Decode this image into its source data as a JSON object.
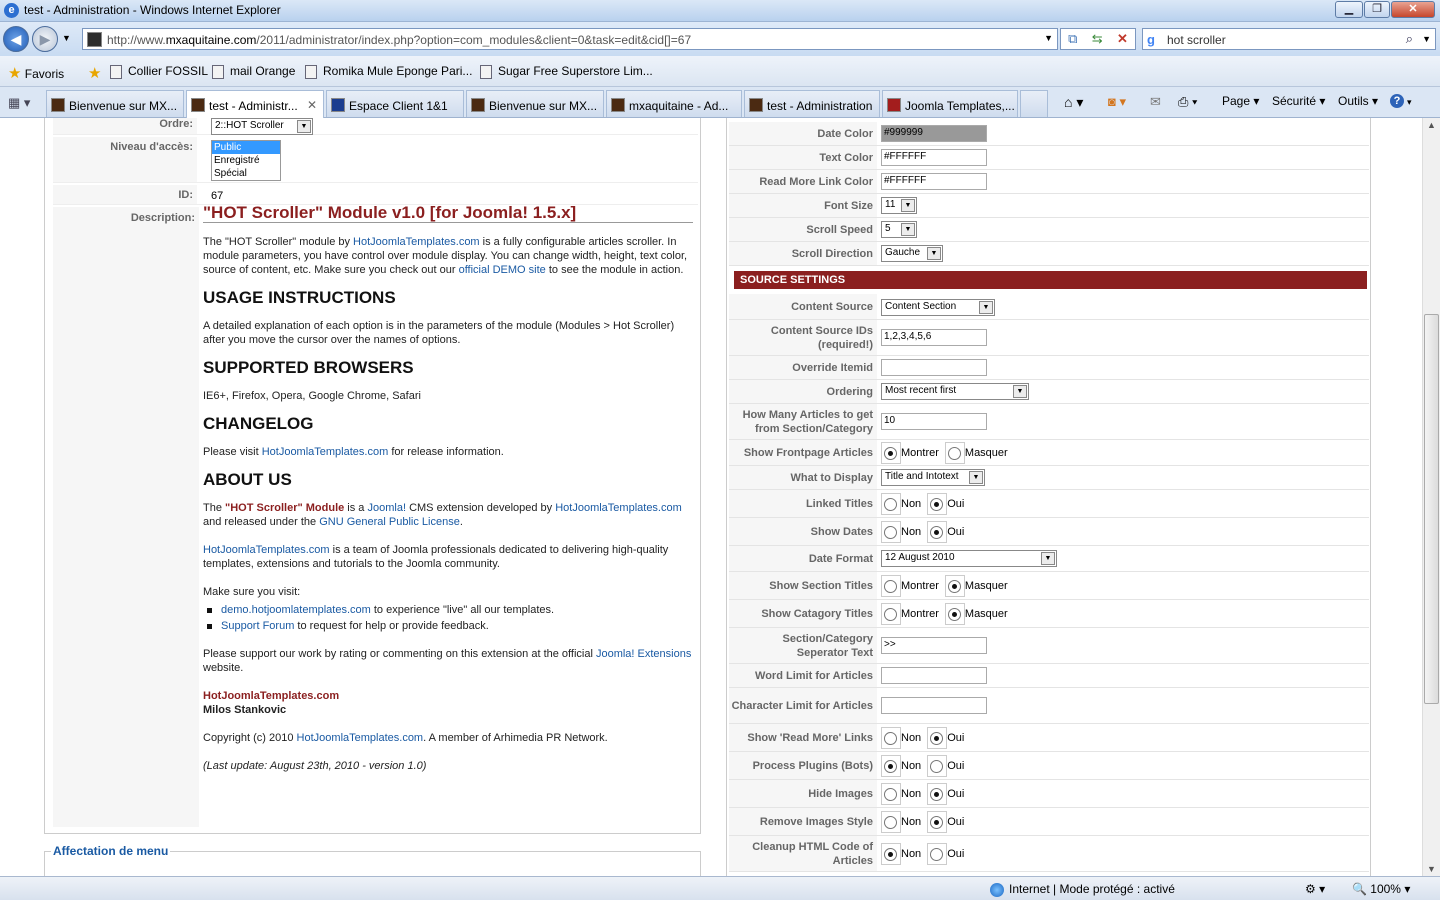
{
  "window": {
    "title": "test - Administration - Windows Internet Explorer",
    "min": "▁",
    "max": "❐",
    "close": "✕"
  },
  "address": {
    "url_prefix": "http://www.",
    "url_domain": "mxaquitaine.com",
    "url_path": "/2011/administrator/index.php?option=com_modules&client=0&task=edit&cid[]=67",
    "search_value": "hot scroller"
  },
  "favorites": {
    "label": "Favoris",
    "items": [
      "Collier FOSSIL",
      "mail Orange",
      "Romika Mule Eponge Pari...",
      "Sugar Free Superstore Lim..."
    ]
  },
  "tabs": [
    "Bienvenue sur MX...",
    "test - Administr...",
    "Espace Client 1&1",
    "Bienvenue sur MX...",
    "mxaquitaine - Ad...",
    "test - Administration",
    "Joomla Templates,..."
  ],
  "commandbar": {
    "page": "Page",
    "security": "Sécurité",
    "tools": "Outils",
    "help": "?"
  },
  "left": {
    "order_label": "Ordre:",
    "order_value": "2::HOT Scroller",
    "access_label": "Niveau d'accès:",
    "access_options": [
      "Public",
      "Enregistré",
      "Spécial"
    ],
    "id_label": "ID:",
    "id_value": "67",
    "description_label": "Description:",
    "desc": {
      "title": "\"HOT Scroller\" Module v1.0 [for Joomla! 1.5.x]",
      "p1a": "The \"HOT Scroller\" module by ",
      "p1link": "HotJoomlaTemplates.com",
      "p1b": " is a fully configurable articles scroller. In module parameters, you have control over module display. You can change width, height, text color, source of content, etc. Make sure you check out our ",
      "p1link2": "official DEMO site",
      "p1c": " to see the module in action.",
      "h_usage": "USAGE INSTRUCTIONS",
      "usage": "A detailed explanation of each option is in the parameters of the module (Modules > Hot Scroller) after you move the cursor over the names of options.",
      "h_browsers": "SUPPORTED BROWSERS",
      "browsers": "IE6+, Firefox, Opera, Google Chrome, Safari",
      "h_changelog": "CHANGELOG",
      "changelog_a": "Please visit ",
      "changelog_link": "HotJoomlaTemplates.com",
      "changelog_b": " for release information.",
      "h_about": "ABOUT US",
      "about_a": "The ",
      "about_red": "\"HOT Scroller\" Module",
      "about_b": " is a ",
      "about_joomla": "Joomla!",
      "about_c": " CMS extension developed by ",
      "about_link": "HotJoomlaTemplates.com",
      "about_d": " and released under the ",
      "about_gpl": "GNU General Public License",
      "about_e": ".",
      "team_link": "HotJoomlaTemplates.com",
      "team": " is a team of Joomla professionals dedicated to delivering high-quality templates, extensions and tutorials to the Joomla community.",
      "visit": "Make sure you visit:",
      "li1_link": "demo.hotjoomlatemplates.com",
      "li1": " to experience \"live\" all our templates.",
      "li2_link": "Support Forum",
      "li2": " to request for help or provide feedback.",
      "support_a": "Please support our work by rating or commenting on this extension at the official ",
      "support_link": "Joomla! Extensions",
      "support_b": " website.",
      "sig_company": "HotJoomlaTemplates.com",
      "sig_name": "Milos Stankovic",
      "copy_a": "Copyright (c) 2010 ",
      "copy_link": "HotJoomlaTemplates.com",
      "copy_b": ". A member of Arhimedia PR Network.",
      "lastupdate": "(Last update: August 23th, 2010 - version 1.0)"
    },
    "menu_assign": "Affectation de menu"
  },
  "right": {
    "date_color_label": "Date Color",
    "date_color": "#999999",
    "text_color_label": "Text Color",
    "text_color": "#FFFFFF",
    "readmore_color_label": "Read More Link Color",
    "readmore_color": "#FFFFFF",
    "font_size_label": "Font Size",
    "font_size": "11",
    "scroll_speed_label": "Scroll Speed",
    "scroll_speed": "5",
    "scroll_dir_label": "Scroll Direction",
    "scroll_dir": "Gauche",
    "source_header": "SOURCE SETTINGS",
    "content_source_label": "Content Source",
    "content_source": "Content Section",
    "content_ids_label": "Content Source IDs (required!)",
    "content_ids": "1,2,3,4,5,6",
    "override_label": "Override Itemid",
    "override": "",
    "ordering_label": "Ordering",
    "ordering": "Most recent first",
    "howmany_label": "How Many Articles to get from Section/Category",
    "howmany": "10",
    "frontpage_label": "Show Frontpage Articles",
    "what_label": "What to Display",
    "what": "Title and Intotext",
    "linked_label": "Linked Titles",
    "dates_label": "Show Dates",
    "datefmt_label": "Date Format",
    "datefmt": "12 August 2010",
    "section_titles_label": "Show Section Titles",
    "cat_titles_label": "Show Catagory Titles",
    "sep_label": "Section/Category Seperator Text",
    "sep": ">>",
    "word_limit_label": "Word Limit for Articles",
    "word_limit": "",
    "char_limit_label": "Character Limit for Articles",
    "char_limit": "",
    "readmore_links_label": "Show 'Read More' Links",
    "plugins_label": "Process Plugins (Bots)",
    "hide_images_label": "Hide Images",
    "remove_style_label": "Remove Images Style",
    "cleanup_label": "Cleanup HTML Code of Articles",
    "montrer": "Montrer",
    "masquer": "Masquer",
    "non": "Non",
    "oui": "Oui"
  },
  "status": {
    "zone": "Internet | Mode protégé : activé",
    "zoom": "100%"
  }
}
